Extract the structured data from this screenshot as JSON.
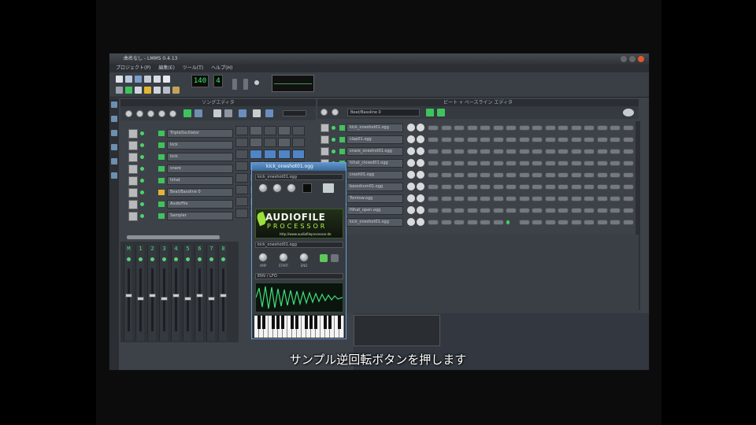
{
  "window": {
    "title": "曲名なし - LMMS 0.4.13"
  },
  "menu": [
    "プロジェクト(P)",
    "編集(E)",
    "ツール(T)",
    "ヘルプ(H)"
  ],
  "toolbar": {
    "tempo": "140",
    "time_sig": "4",
    "colors": {
      "lcd": "#3cf06a"
    }
  },
  "song_editor": {
    "title": "ソングエディタ",
    "tracks": [
      {
        "name": "TripleOscillator",
        "icon": "synth-icon"
      },
      {
        "name": "kick",
        "icon": "sample-icon"
      },
      {
        "name": "kick",
        "icon": "sample-icon"
      },
      {
        "name": "snare",
        "icon": "sample-icon"
      },
      {
        "name": "hihat",
        "icon": "sample-icon"
      },
      {
        "name": "Beat/Bassline 0",
        "icon": "folder-icon"
      },
      {
        "name": "AudioFile",
        "icon": "sample-icon"
      },
      {
        "name": "Sampler",
        "icon": "sample-icon"
      }
    ]
  },
  "mixer": {
    "channels": [
      "M",
      "1",
      "2",
      "3",
      "4",
      "5",
      "6",
      "7",
      "8"
    ]
  },
  "plugin": {
    "title": "kick_oneshot01.ogg",
    "field1": "kick_oneshot01.ogg",
    "brand_main": "AUDIOFILE",
    "brand_sub": "PROCESSOR",
    "brand_url": "http://www.audiofileprocessor.de",
    "sample_file": "kick_oneshot01.ogg",
    "knobs": [
      "AMP",
      "START",
      "END"
    ],
    "bottom_label": "ENV / LFO"
  },
  "bb_editor": {
    "title": "ビート + ベースライン エディタ",
    "pattern": "Beat/Bassline 0",
    "tracks": [
      "kick_oneshot01.ogg",
      "clap01.ogg",
      "snare_oneshot01.ogg",
      "hihat_closed01.ogg",
      "crash01.ogg",
      "bassdrum01.ogg",
      "Tomlow.ogg",
      "Hihat_open.ogg",
      "kick_oneshot01.ogg"
    ]
  },
  "subtitle": "サンプル逆回転ボタンを押します"
}
